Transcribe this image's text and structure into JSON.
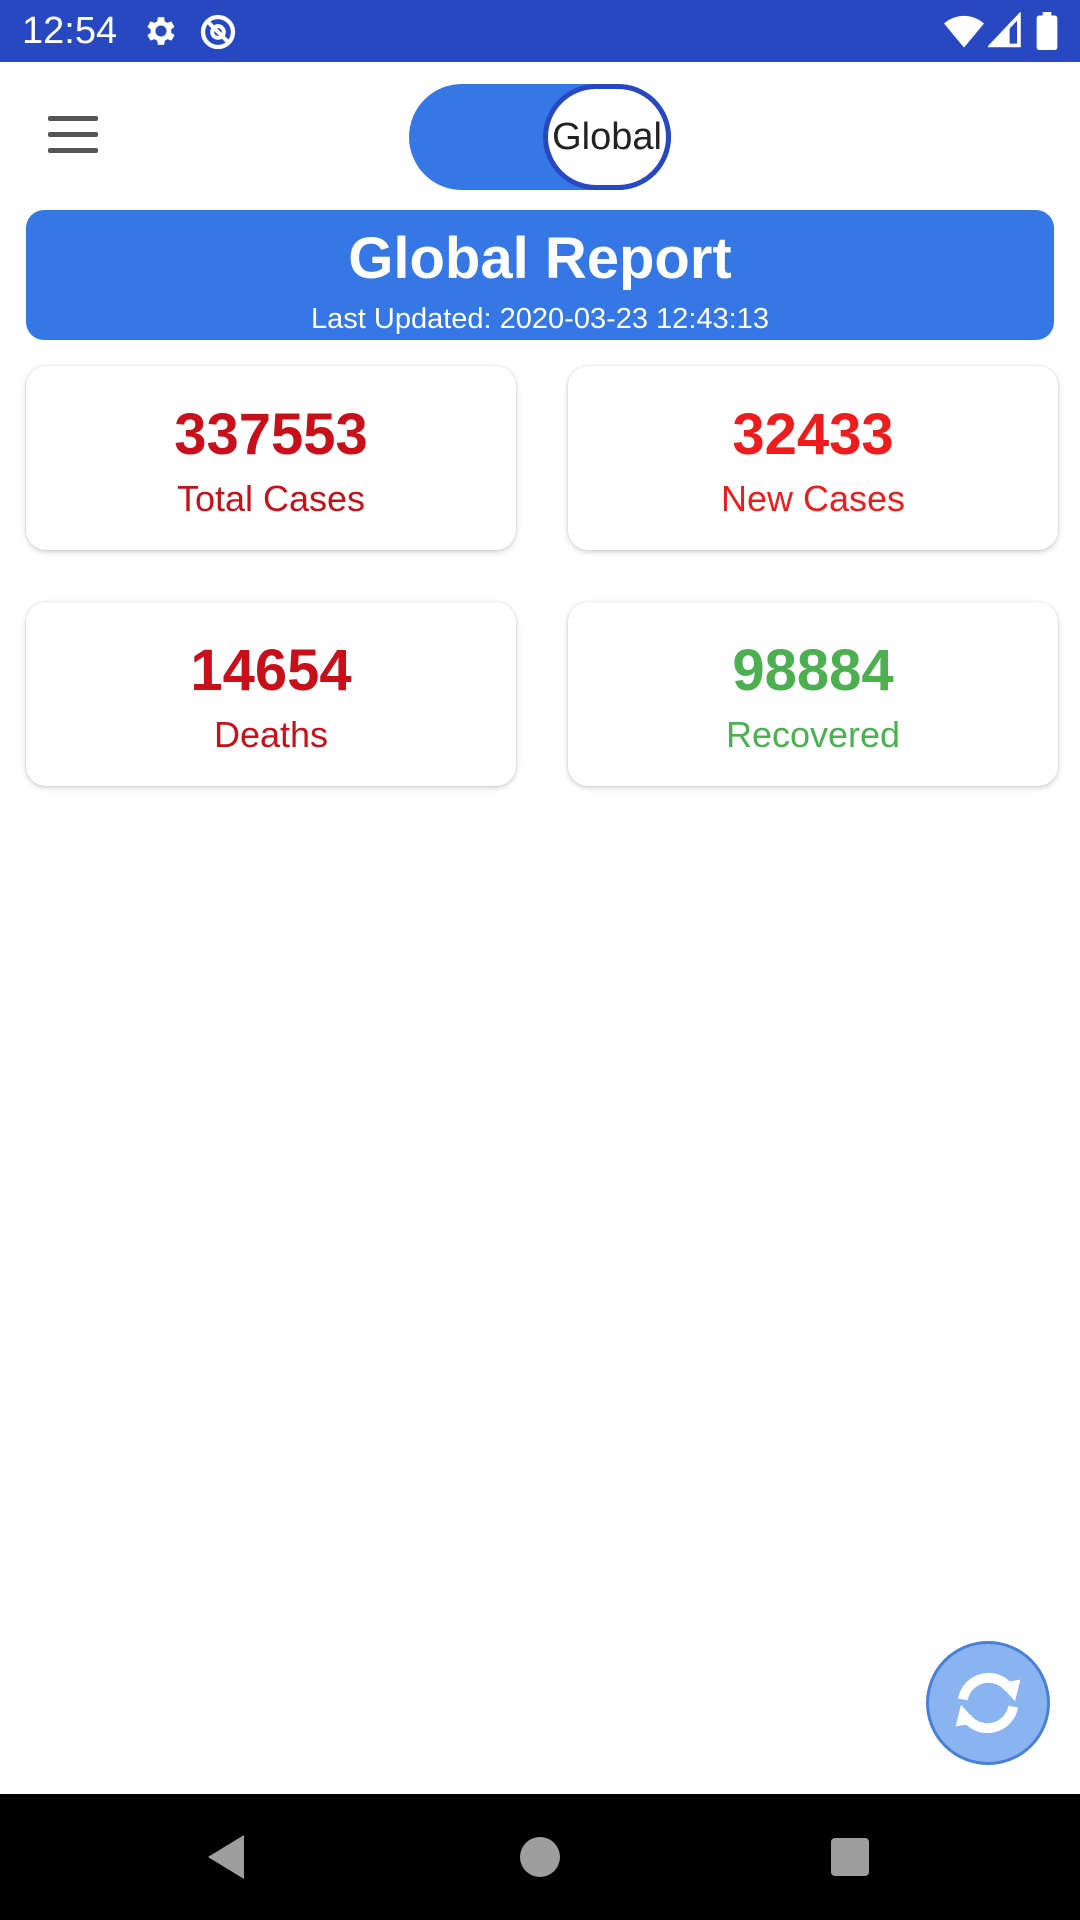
{
  "status_bar": {
    "time": "12:54",
    "icons": [
      "gear-icon",
      "at-icon",
      "wifi-icon",
      "signal-icon",
      "battery-icon"
    ]
  },
  "header": {
    "menu_icon": "menu-icon",
    "scope_toggle_label": "Global",
    "accent_color": "#3578e5"
  },
  "report": {
    "title": "Global Report",
    "last_updated": "Last Updated: 2020-03-23 12:43:13"
  },
  "stats": [
    {
      "value": "337553",
      "label": "Total Cases",
      "color": "#c8101a"
    },
    {
      "value": "32433",
      "label": "New Cases",
      "color": "#ee1c1c"
    },
    {
      "value": "14654",
      "label": "Deaths",
      "color": "#c8101a"
    },
    {
      "value": "98884",
      "label": "Recovered",
      "color": "#4caf50"
    }
  ],
  "fab": {
    "icon": "refresh-icon"
  },
  "nav": {
    "icons": [
      "back-icon",
      "home-icon",
      "recents-icon"
    ]
  }
}
